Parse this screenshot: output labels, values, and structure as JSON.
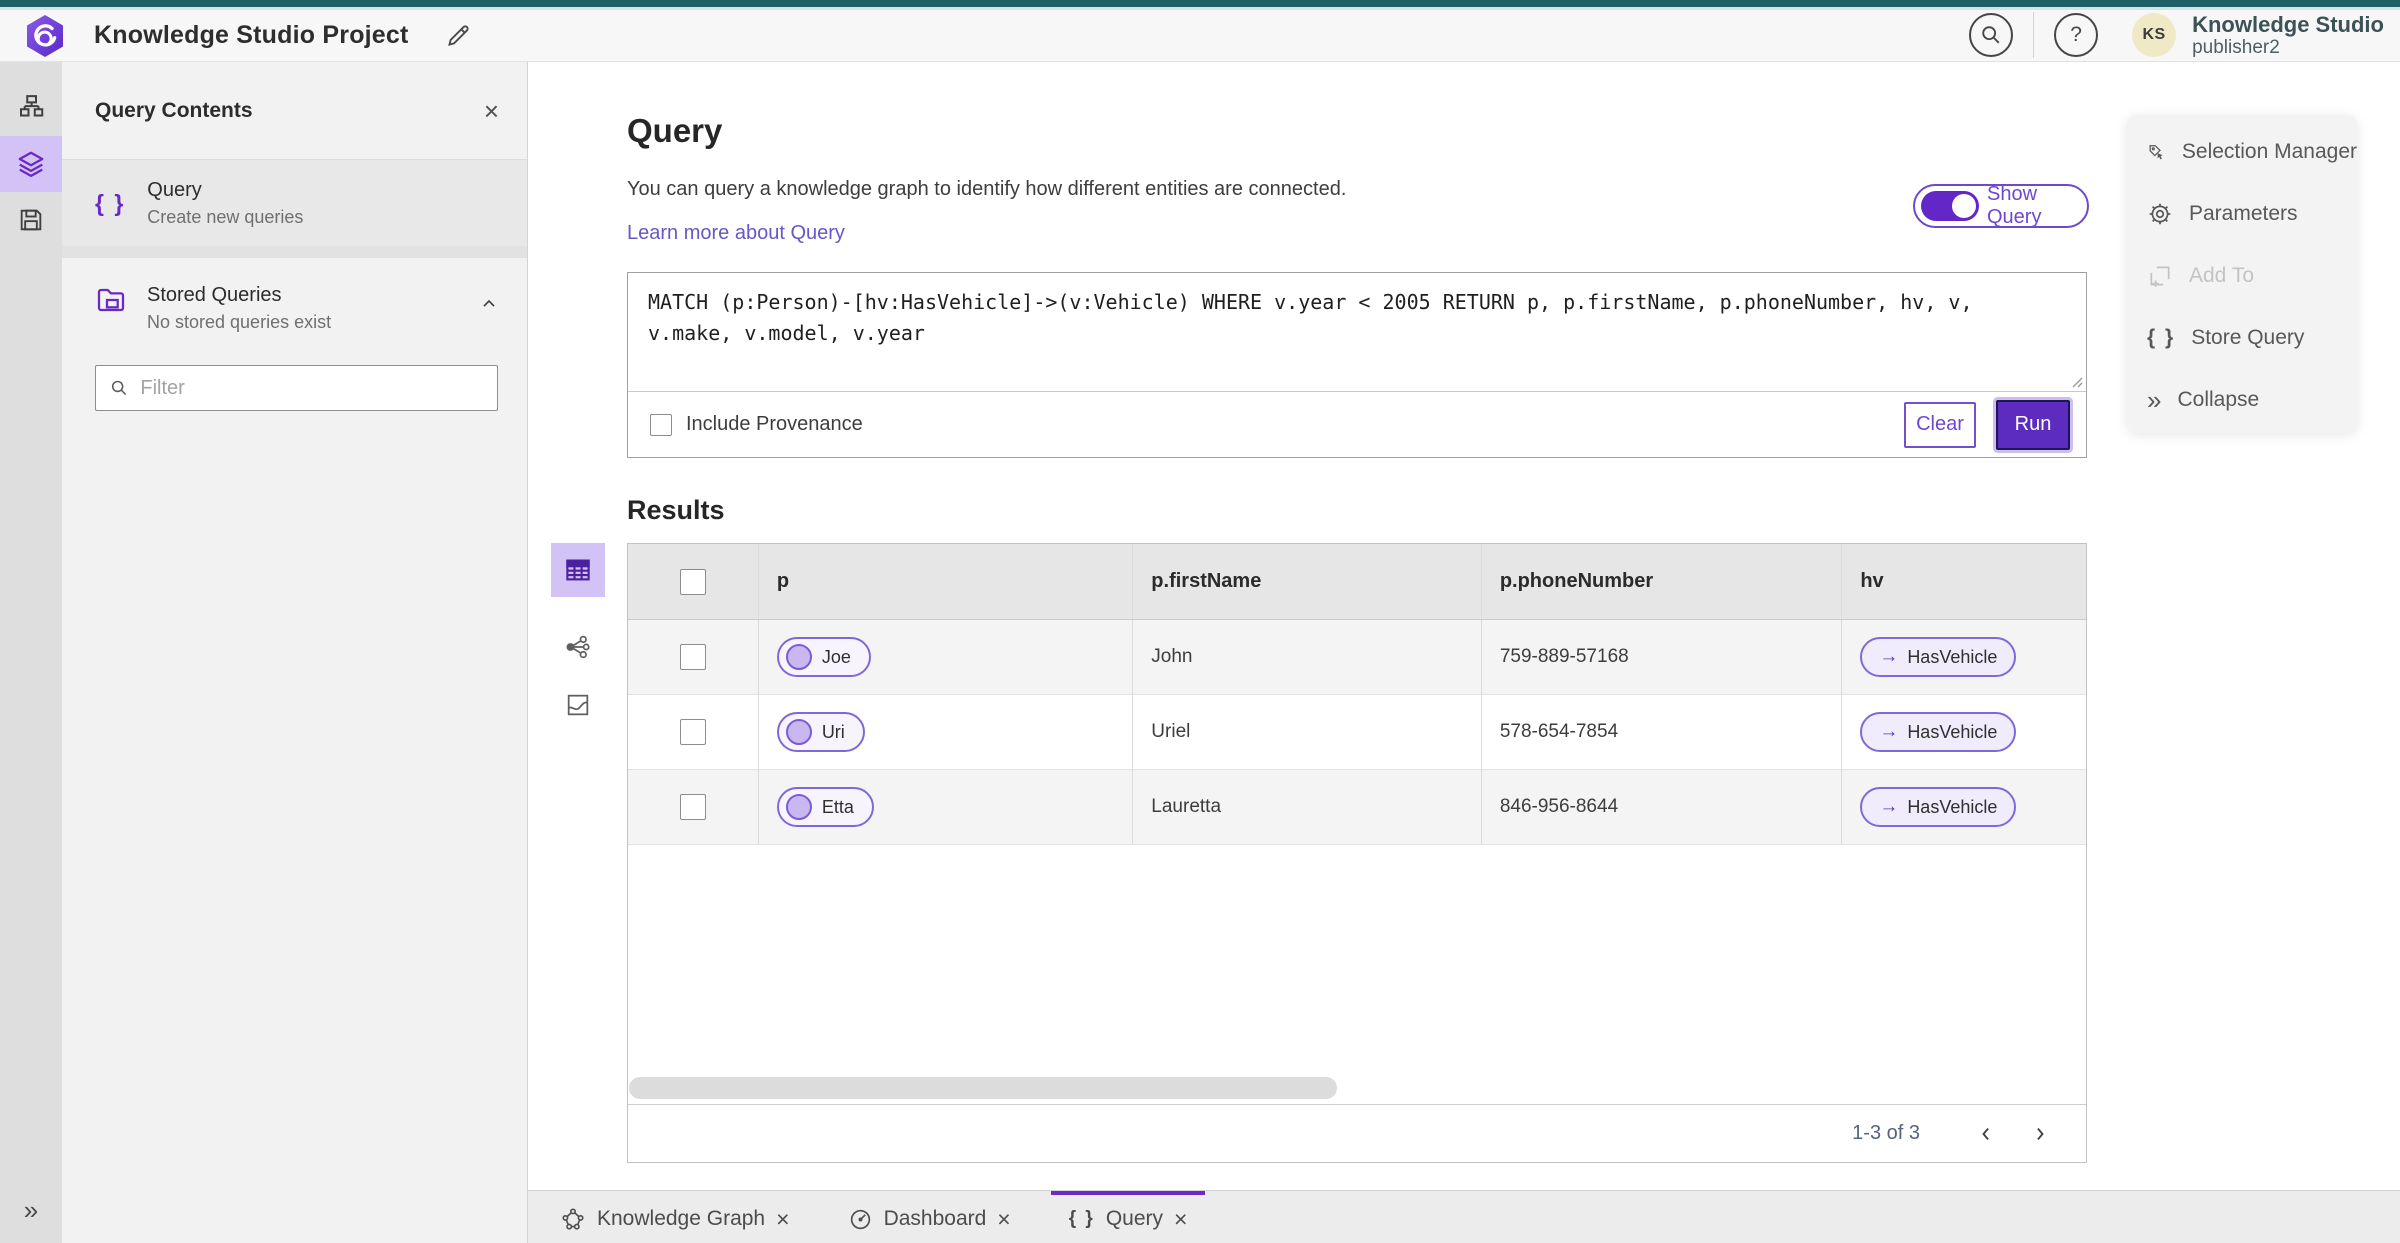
{
  "colors": {
    "accent_purple": "#6929c4",
    "run_button_purple": "#5b2cbf",
    "top_stripe_teal": "#1f5f66",
    "link_purple": "#6458c8",
    "active_highlight": "#d3c2f5"
  },
  "icons": {
    "close": "×",
    "question": "?",
    "braces": "{ }",
    "collapse_chevrons": "»",
    "arrow_right": "→"
  },
  "header": {
    "title": "Knowledge Studio Project",
    "user_name": "Knowledge Studio",
    "user_role": "publisher2",
    "avatar_initials": "KS"
  },
  "contents_panel": {
    "title": "Query Contents",
    "query_item": {
      "label": "Query",
      "sublabel": "Create new queries"
    },
    "stored_queries": {
      "label": "Stored Queries",
      "sublabel": "No stored queries exist"
    },
    "filter_placeholder": "Filter"
  },
  "query_section": {
    "title": "Query",
    "description": "You can query a knowledge graph to identify how different entities are connected.",
    "learn_more_link": "Learn more about Query",
    "show_query_label": "Show Query",
    "query_text": "MATCH (p:Person)-[hv:HasVehicle]->(v:Vehicle) WHERE v.year < 2005 RETURN p, p.firstName, p.phoneNumber, hv, v, v.make, v.model, v.year",
    "include_provenance_label": "Include Provenance",
    "clear_button": "Clear",
    "run_button": "Run"
  },
  "actions_panel": {
    "items": [
      {
        "label": "Selection Manager",
        "disabled": false
      },
      {
        "label": "Parameters",
        "disabled": false
      },
      {
        "label": "Add To",
        "disabled": true
      },
      {
        "label": "Store Query",
        "disabled": false
      },
      {
        "label": "Collapse",
        "disabled": false
      }
    ]
  },
  "results": {
    "title": "Results",
    "columns": [
      "p",
      "p.firstName",
      "p.phoneNumber",
      "hv"
    ],
    "rows": [
      {
        "p": "Joe",
        "firstName": "John",
        "phoneNumber": "759-889-57168",
        "hv": "HasVehicle"
      },
      {
        "p": "Uri",
        "firstName": "Uriel",
        "phoneNumber": "578-654-7854",
        "hv": "HasVehicle"
      },
      {
        "p": "Etta",
        "firstName": "Lauretta",
        "phoneNumber": "846-956-8644",
        "hv": "HasVehicle"
      }
    ],
    "pagination": "1-3 of 3"
  },
  "bottom_tabs": [
    {
      "label": "Knowledge Graph",
      "active": false
    },
    {
      "label": "Dashboard",
      "active": false
    },
    {
      "label": "Query",
      "active": true
    }
  ]
}
